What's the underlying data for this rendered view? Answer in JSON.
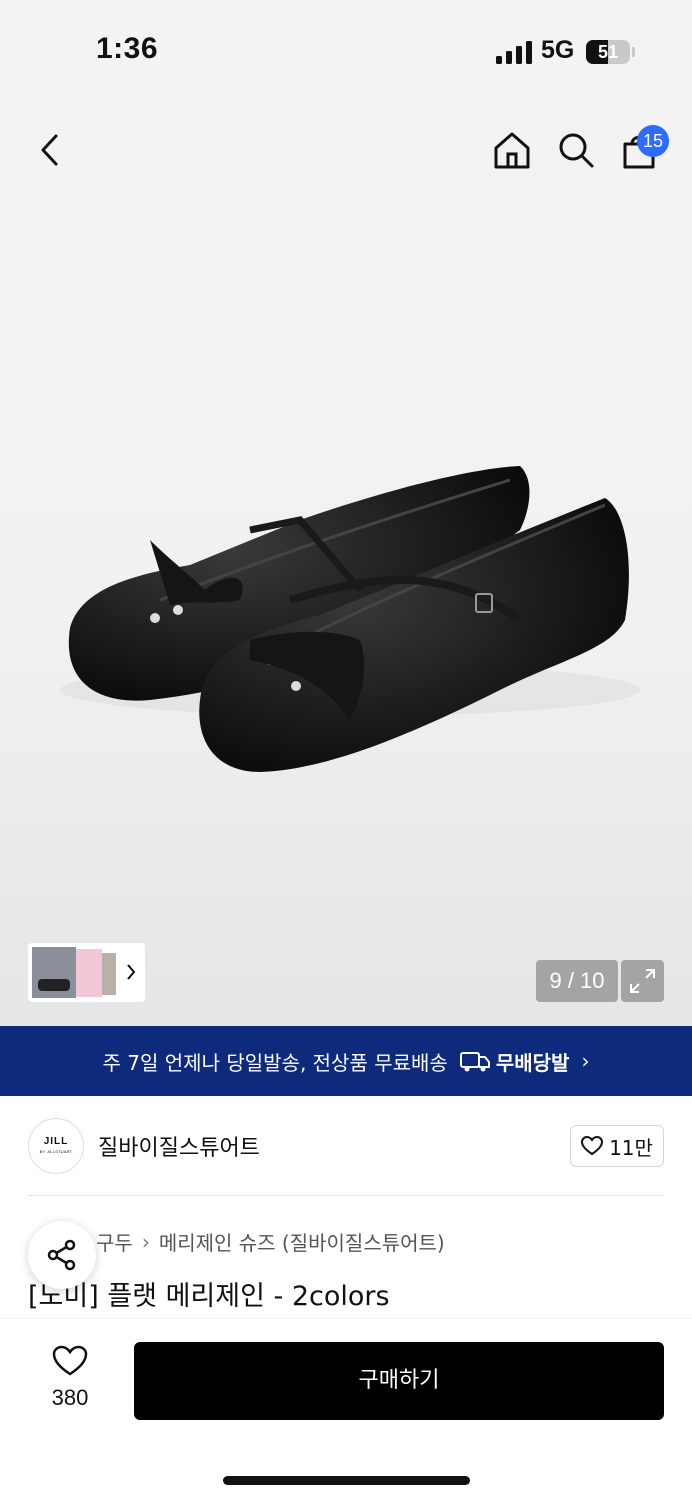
{
  "status_bar": {
    "time": "1:36",
    "network": "5G",
    "battery": "51",
    "battery_level": 0.51
  },
  "header": {
    "back_icon": "chevron-left-icon",
    "home_icon": "home-icon",
    "search_icon": "search-icon",
    "cart_icon": "shopping-bag-icon",
    "cart_count": "15",
    "badge_color": "#2f6bff"
  },
  "gallery": {
    "counter": "9 / 10",
    "expand_icon": "expand-icon",
    "thumb_chevron": "chevron-right-icon"
  },
  "promo": {
    "text": "주 7일 언제나 당일발송, 전상품 무료배송",
    "badge": "무배당발",
    "badge_icon": "delivery-truck-icon",
    "chevron": "›",
    "background": "#0d2a7c"
  },
  "brand": {
    "logo_main": "JILL",
    "logo_sub": "BY JILLSTUART",
    "name": "질바이질스튜어트",
    "like_count": "11만"
  },
  "breadcrumb": {
    "items": [
      "구두",
      "메리제인 슈즈 (질바이질스튜어트)"
    ]
  },
  "product": {
    "title": "[노미] 플랫 메리제인 - 2colors"
  },
  "bottom_bar": {
    "wish_count": "380",
    "buy_label": "구매하기"
  }
}
